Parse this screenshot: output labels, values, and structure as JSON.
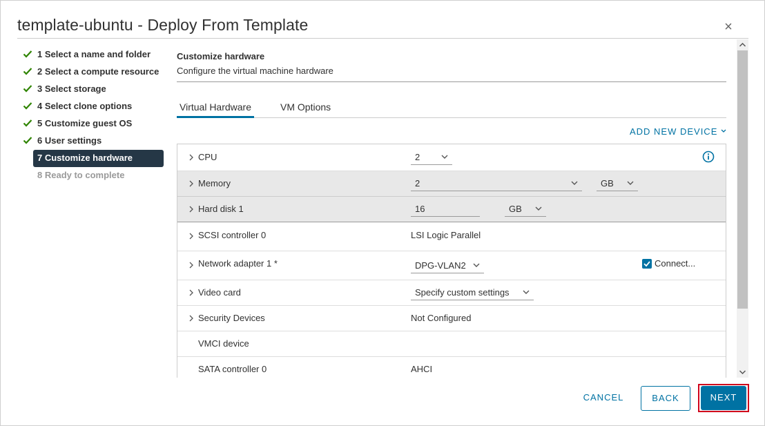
{
  "dialog": {
    "title": "template-ubuntu - Deploy From Template",
    "close_glyph": "×"
  },
  "steps": [
    {
      "label": "1 Select a name and folder",
      "state": "done"
    },
    {
      "label": "2 Select a compute resource",
      "state": "done"
    },
    {
      "label": "3 Select storage",
      "state": "done"
    },
    {
      "label": "4 Select clone options",
      "state": "done"
    },
    {
      "label": "5 Customize guest OS",
      "state": "done"
    },
    {
      "label": "6 User settings",
      "state": "done"
    },
    {
      "label": "7 Customize hardware",
      "state": "active"
    },
    {
      "label": "8 Ready to complete",
      "state": "disabled"
    }
  ],
  "section": {
    "title": "Customize hardware",
    "subtitle": "Configure the virtual machine hardware"
  },
  "tabs": [
    {
      "label": "Virtual Hardware",
      "active": true
    },
    {
      "label": "VM Options",
      "active": false
    }
  ],
  "add_device": {
    "label": "ADD NEW DEVICE"
  },
  "hardware": {
    "cpu": {
      "label": "CPU",
      "value": "2"
    },
    "memory": {
      "label": "Memory",
      "value": "2",
      "unit": "GB"
    },
    "hard_disk": {
      "label": "Hard disk 1",
      "value": "16",
      "unit": "GB"
    },
    "scsi": {
      "label": "SCSI controller 0",
      "value": "LSI Logic Parallel"
    },
    "network": {
      "label": "Network adapter 1 *",
      "value": "DPG-VLAN2",
      "connect_label": "Connect...",
      "connected": true
    },
    "video": {
      "label": "Video card",
      "value": "Specify custom settings"
    },
    "security": {
      "label": "Security Devices",
      "value": "Not Configured"
    },
    "vmci": {
      "label": "VMCI device"
    },
    "sata": {
      "label": "SATA controller 0",
      "value": "AHCI"
    }
  },
  "footer": {
    "cancel": "CANCEL",
    "back": "BACK",
    "next": "NEXT"
  },
  "colors": {
    "accent": "#0072a3",
    "active_step_bg": "#253746",
    "check": "#2f8400",
    "highlight": "#d0021b"
  }
}
